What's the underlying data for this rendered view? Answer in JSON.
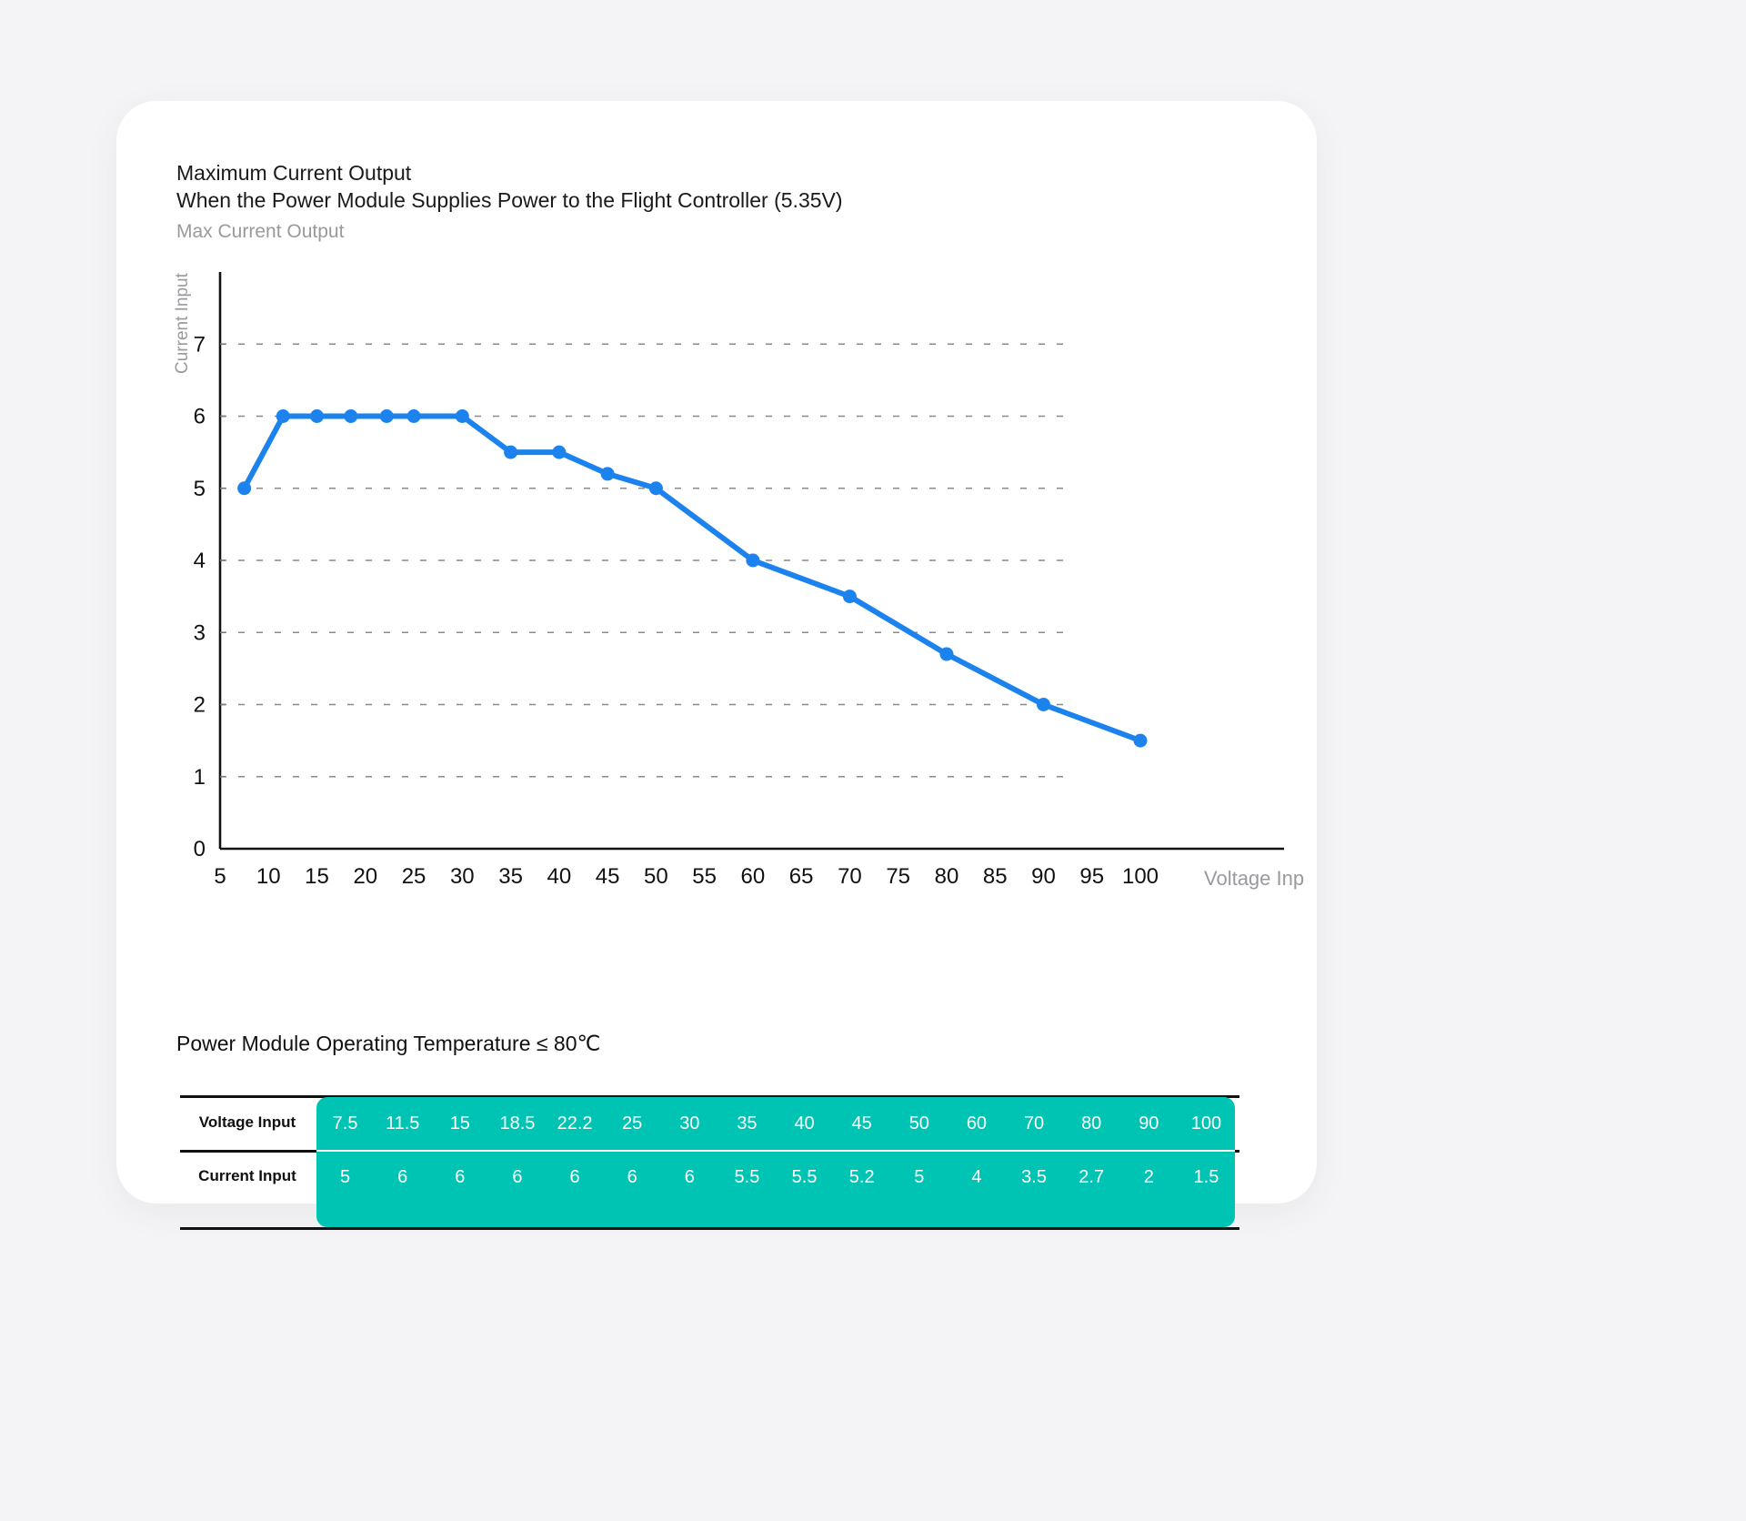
{
  "card": {
    "title_line1": "Maximum Current Output",
    "title_line2": "When the Power Module Supplies Power to the Flight Controller (5.35V)",
    "series_label": "Max Current Output"
  },
  "table": {
    "title": "Power Module Operating Temperature ≤ 80℃",
    "row_labels": [
      "Voltage Input",
      "Current Input"
    ],
    "voltage": [
      "7.5",
      "11.5",
      "15",
      "18.5",
      "22.2",
      "25",
      "30",
      "35",
      "40",
      "45",
      "50",
      "60",
      "70",
      "80",
      "90",
      "100"
    ],
    "current": [
      "5",
      "6",
      "6",
      "6",
      "6",
      "6",
      "6",
      "5.5",
      "5.5",
      "5.2",
      "5",
      "4",
      "3.5",
      "2.7",
      "2",
      "1.5"
    ],
    "accent_color": "#00c4b3"
  },
  "chart_data": {
    "type": "line",
    "title": "Maximum Current Output",
    "subtitle": "When the Power Module Supplies Power to the Flight Controller (5.35V)",
    "series_name": "Max Current Output",
    "xlabel": "Voltage Input",
    "ylabel": "Current Input",
    "x": [
      7.5,
      11.5,
      15,
      18.5,
      22.2,
      25,
      30,
      35,
      40,
      45,
      50,
      60,
      70,
      80,
      90,
      100
    ],
    "values": [
      5,
      6,
      6,
      6,
      6,
      6,
      6,
      5.5,
      5.5,
      5.2,
      5,
      4,
      3.5,
      2.7,
      2,
      1.5
    ],
    "xticks": [
      "5",
      "10",
      "15",
      "20",
      "25",
      "30",
      "35",
      "40",
      "45",
      "50",
      "55",
      "60",
      "65",
      "70",
      "75",
      "80",
      "85",
      "90",
      "95",
      "100"
    ],
    "yticks": [
      "0",
      "1",
      "2",
      "3",
      "4",
      "5",
      "6",
      "7"
    ],
    "xlim": [
      5,
      100
    ],
    "ylim": [
      0,
      8
    ],
    "grid": "horizontal-dashed",
    "legend": "none",
    "line_color": "#1b82ee",
    "marker": "circle"
  }
}
